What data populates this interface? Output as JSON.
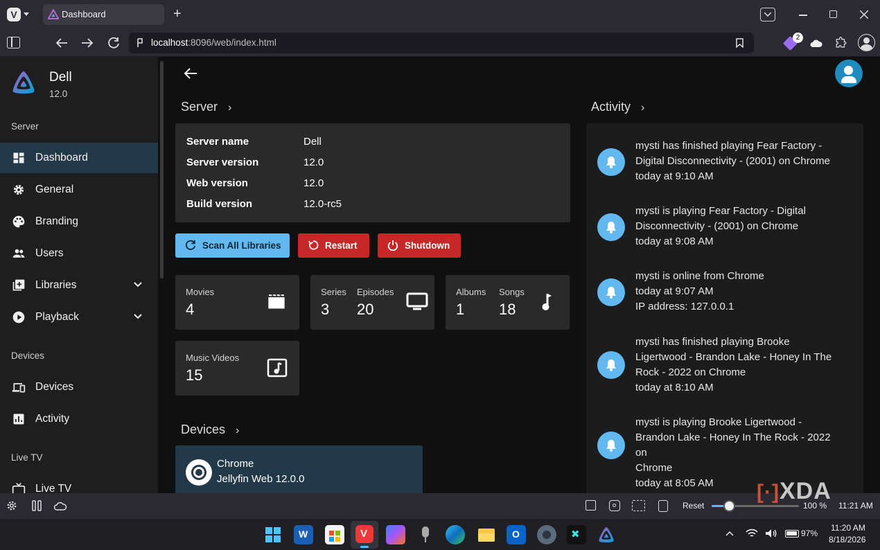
{
  "browser": {
    "tab_title": "Dashboard",
    "url_host": "localhost",
    "url_path": ":8096/web/index.html",
    "extension_badge": "2"
  },
  "sidebar": {
    "server_name": "Dell",
    "server_version": "12.0",
    "section_server": "Server",
    "section_devices": "Devices",
    "section_livetv": "Live TV",
    "items": {
      "dashboard": "Dashboard",
      "general": "General",
      "branding": "Branding",
      "users": "Users",
      "libraries": "Libraries",
      "playback": "Playback",
      "devices": "Devices",
      "activity": "Activity",
      "livetv": "Live TV"
    }
  },
  "server": {
    "section_title": "Server",
    "rows": [
      {
        "key": "Server name",
        "value": "Dell"
      },
      {
        "key": "Server version",
        "value": "12.0"
      },
      {
        "key": "Web version",
        "value": "12.0"
      },
      {
        "key": "Build version",
        "value": "12.0-rc5"
      }
    ],
    "buttons": {
      "scan": "Scan All Libraries",
      "restart": "Restart",
      "shutdown": "Shutdown"
    }
  },
  "stats": {
    "movies_label": "Movies",
    "movies_value": "4",
    "series_label": "Series",
    "series_value": "3",
    "episodes_label": "Episodes",
    "episodes_value": "20",
    "albums_label": "Albums",
    "albums_value": "1",
    "songs_label": "Songs",
    "songs_value": "18",
    "musicvideos_label": "Music Videos",
    "musicvideos_value": "15"
  },
  "devices": {
    "section_title": "Devices",
    "device_name": "Chrome",
    "device_app": "Jellyfin Web 12.0.0"
  },
  "activity": {
    "section_title": "Activity",
    "items": [
      {
        "lines": [
          "mysti has finished playing Fear Factory -",
          "Digital Disconnectivity - (2001) on Chrome",
          "today at 9:10 AM"
        ]
      },
      {
        "lines": [
          "mysti is playing Fear Factory - Digital",
          "Disconnectivity - (2001) on Chrome",
          "today at 9:08 AM"
        ]
      },
      {
        "lines": [
          "mysti is online from Chrome",
          "today at 9:07 AM",
          "IP address: 127.0.0.1"
        ]
      },
      {
        "lines": [
          "mysti has finished playing Brooke",
          "Ligertwood - Brandon Lake - Honey In The",
          "Rock - 2022 on Chrome",
          "today at 8:10 AM"
        ]
      },
      {
        "lines": [
          "mysti is playing Brooke Ligertwood -",
          "Brandon Lake - Honey In The Rock - 2022 on",
          "Chrome",
          "today at 8:05 AM"
        ]
      }
    ]
  },
  "statusbar": {
    "reset_label": "Reset",
    "zoom": "100 %",
    "zoom_fraction": 0.2,
    "clock": "11:21 AM"
  },
  "watermark": "XDA",
  "taskbar": {
    "battery": "97%",
    "time": "11:20 AM",
    "date": "8/18/2026"
  },
  "colors": {
    "accent_blue": "#62b9ef",
    "restart_red": "#c62828",
    "active_nav": "#22394a",
    "jellyfin_purple": "#aa5cc3"
  }
}
